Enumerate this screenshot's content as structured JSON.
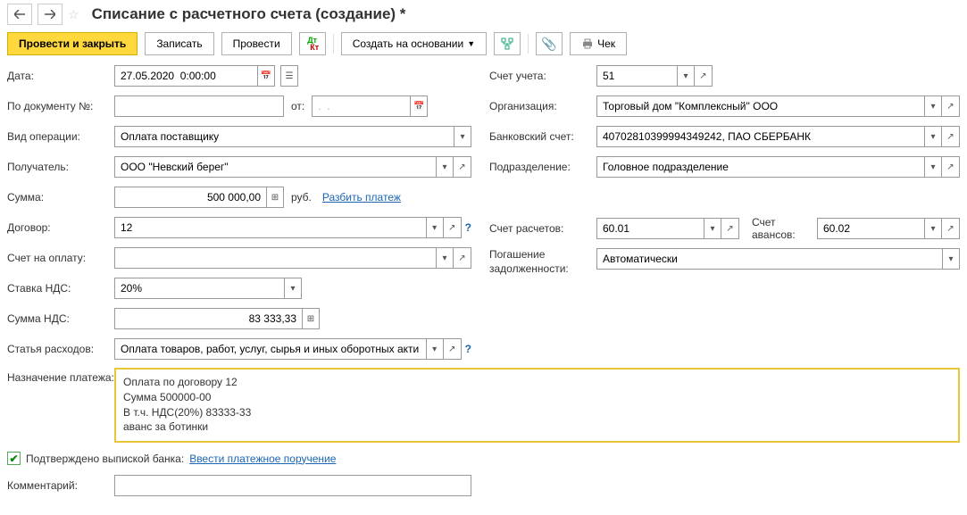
{
  "title": "Списание с расчетного счета (создание) *",
  "toolbar": {
    "post_close": "Провести и закрыть",
    "save": "Записать",
    "post": "Провести",
    "create_based": "Создать на основании",
    "check": "Чек"
  },
  "fields": {
    "date_label": "Дата:",
    "date_value": "27.05.2020  0:00:00",
    "docnum_label": "По документу №:",
    "docnum_value": "",
    "docnum_from": "от:",
    "docnum_date": ".  .",
    "optype_label": "Вид операции:",
    "optype_value": "Оплата поставщику",
    "recipient_label": "Получатель:",
    "recipient_value": "ООО \"Невский берег\"",
    "sum_label": "Сумма:",
    "sum_value": "500 000,00",
    "sum_currency": "руб.",
    "split_link": "Разбить платеж",
    "contract_label": "Договор:",
    "contract_value": "12",
    "invoice_label": "Счет на оплату:",
    "invoice_value": "",
    "vat_rate_label": "Ставка НДС:",
    "vat_rate_value": "20%",
    "vat_sum_label": "Сумма НДС:",
    "vat_sum_value": "83 333,33",
    "expense_label": "Статья расходов:",
    "expense_value": "Оплата товаров, работ, услуг, сырья и иных оборотных акти",
    "account_label": "Счет учета:",
    "account_value": "51",
    "org_label": "Организация:",
    "org_value": "Торговый дом \"Комплексный\" ООО",
    "bank_label": "Банковский счет:",
    "bank_value": "40702810399994349242, ПАО СБЕРБАНК",
    "dept_label": "Подразделение:",
    "dept_value": "Головное подразделение",
    "settle_acc_label": "Счет расчетов:",
    "settle_acc_value": "60.01",
    "advance_acc_label": "Счет авансов:",
    "advance_acc_value": "60.02",
    "debt_label": "Погашение задолженности:",
    "debt_value": "Автоматически",
    "purpose_label": "Назначение платежа:",
    "purpose_l1": "Оплата по договору 12",
    "purpose_l2": "Сумма 500000-00",
    "purpose_l3": "В т.ч. НДС(20%) 83333-33",
    "purpose_l4": "аванс за ботинки",
    "confirmed_label": "Подтверждено выпиской банка:",
    "enter_payment_link": "Ввести платежное поручение",
    "comment_label": "Комментарий:",
    "comment_value": ""
  }
}
